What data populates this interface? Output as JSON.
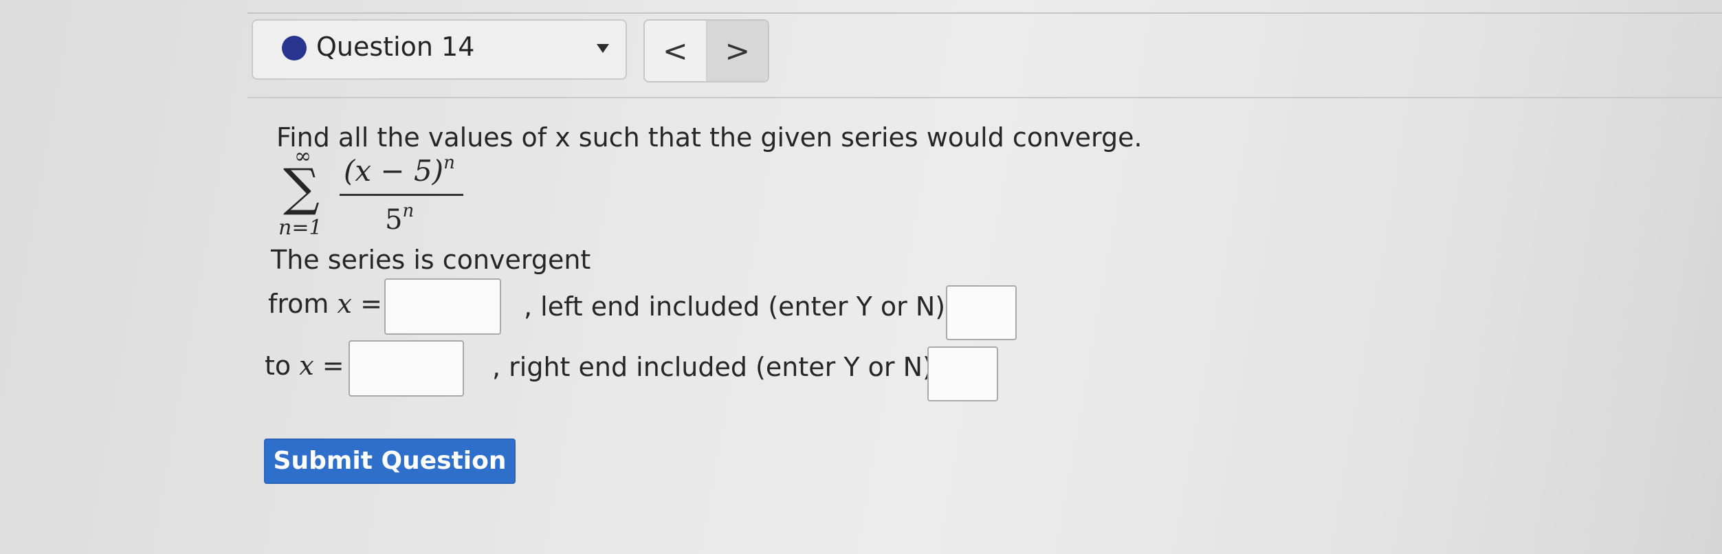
{
  "question": {
    "title": "Question 14",
    "status_color": "#27358f"
  },
  "nav": {
    "prev_label": "<",
    "next_label": ">"
  },
  "problem": {
    "prompt": "Find all the values of x such that the given series would converge.",
    "series": {
      "upper_limit": "∞",
      "sum_symbol": "∑",
      "lower_limit": "n=1",
      "numerator_base": "(x − 5)",
      "numerator_exp": "n",
      "denominator_base": "5",
      "denominator_exp": "n"
    },
    "convergent_text": "The series is convergent",
    "from_label": "from",
    "to_label": "to",
    "var": "x",
    "equals": "=",
    "left_end_text": ", left end included (enter Y or N):",
    "right_end_text": ", right end included (enter Y or N):"
  },
  "inputs": {
    "from_value": "",
    "left_end_value": "",
    "to_value": "",
    "right_end_value": ""
  },
  "submit": {
    "label": "Submit Question",
    "color": "#2e6fcb"
  }
}
